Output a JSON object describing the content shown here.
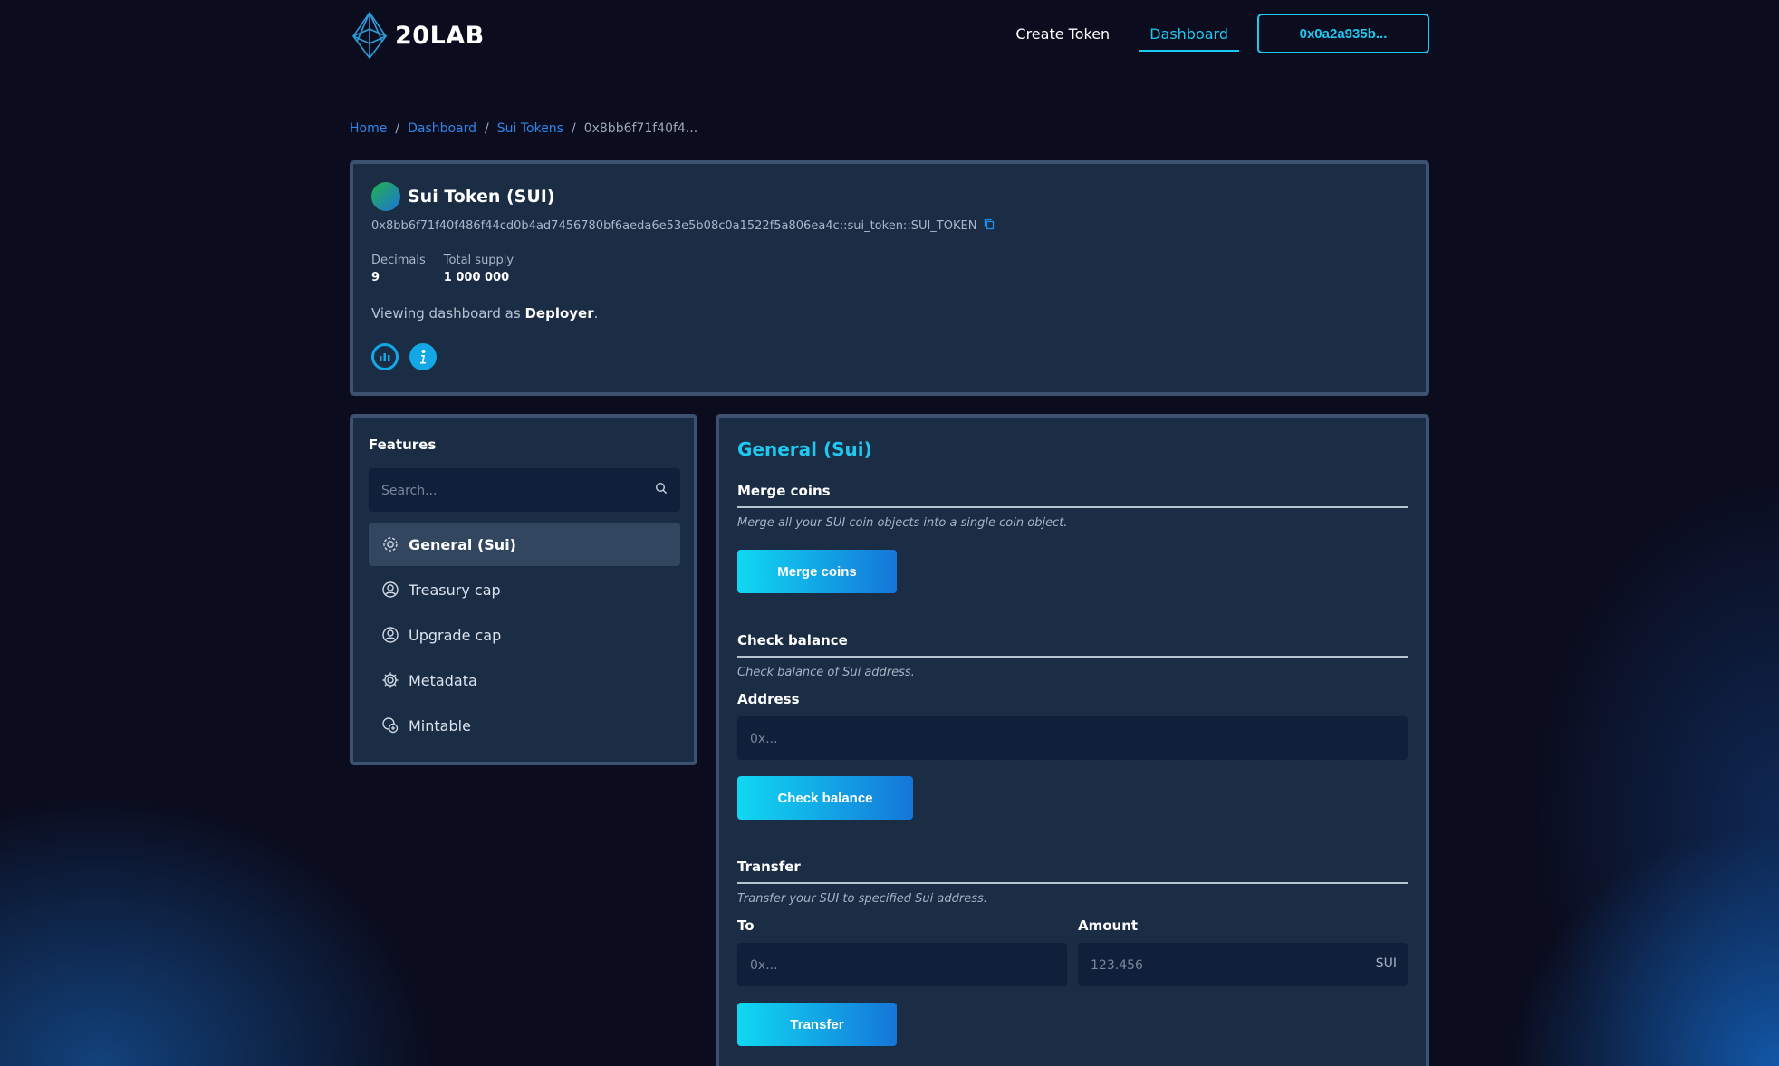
{
  "brand": {
    "name": "20LAB"
  },
  "nav": {
    "create_token": "Create Token",
    "dashboard": "Dashboard",
    "wallet": "0x0a2a935b..."
  },
  "breadcrumb": {
    "home": "Home",
    "dashboard": "Dashboard",
    "sui_tokens": "Sui Tokens",
    "current": "0x8bb6f71f40f4..."
  },
  "token": {
    "name": "Sui Token (SUI)",
    "address": "0x8bb6f71f40f486f44cd0b4ad7456780bf6aeda6e53e5b08c0a1522f5a806ea4c::sui_token::SUI_TOKEN",
    "decimals_label": "Decimals",
    "decimals": "9",
    "supply_label": "Total supply",
    "supply": "1 000 000",
    "viewing_prefix": "Viewing dashboard as ",
    "role": "Deployer",
    "viewing_suffix": "."
  },
  "features": {
    "title": "Features",
    "search_placeholder": "Search...",
    "items": [
      {
        "label": "General (Sui)",
        "icon": "gear-icon",
        "active": true
      },
      {
        "label": "Treasury cap",
        "icon": "user-circle-icon"
      },
      {
        "label": "Upgrade cap",
        "icon": "user-circle-icon"
      },
      {
        "label": "Metadata",
        "icon": "gear-icon"
      },
      {
        "label": "Mintable",
        "icon": "coin-icon"
      }
    ]
  },
  "main": {
    "title": "General (Sui)",
    "merge": {
      "heading": "Merge coins",
      "desc": "Merge all your SUI coin objects into a single coin object.",
      "button": "Merge coins"
    },
    "check": {
      "heading": "Check balance",
      "desc": "Check balance of Sui address.",
      "address_label": "Address",
      "address_placeholder": "0x...",
      "button": "Check balance"
    },
    "transfer": {
      "heading": "Transfer",
      "desc": "Transfer your SUI to specified Sui address.",
      "to_label": "To",
      "to_placeholder": "0x...",
      "amount_label": "Amount",
      "amount_placeholder": "123.456",
      "unit": "SUI",
      "button": "Transfer"
    }
  },
  "colors": {
    "accent": "#1ec8f0",
    "link": "#2f86e8",
    "card_bg": "#1b2c45",
    "card_border": "#3d5270",
    "page_bg": "#0b0d1f"
  }
}
